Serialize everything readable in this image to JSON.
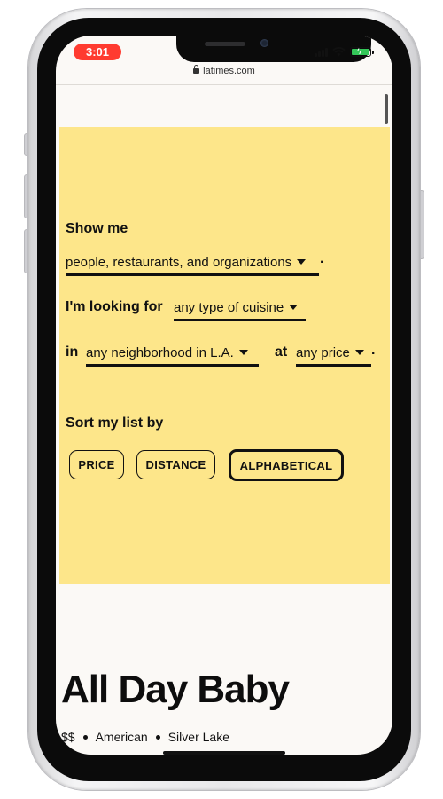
{
  "status_bar": {
    "time": "3:01"
  },
  "browser": {
    "url": "latimes.com"
  },
  "filter": {
    "show_me_label": "Show me",
    "show_me_value": "people, restaurants, and organizations",
    "period": ".",
    "looking_for_label": "I'm looking for",
    "cuisine_value": "any type of cuisine",
    "in_label": "in",
    "neighborhood_value": "any neighborhood in L.A.",
    "at_label": "at",
    "price_value": "any price",
    "sort_label": "Sort my list by",
    "sort_buttons": [
      "PRICE",
      "DISTANCE",
      "ALPHABETICAL"
    ],
    "sort_active": "ALPHABETICAL"
  },
  "result": {
    "title": "All Day Baby",
    "price": "$$",
    "cuisine": "American",
    "neighborhood": "Silver Lake"
  },
  "colors": {
    "panel": "#fde68a",
    "page_bg": "#fbf9f6",
    "time_pill": "#ff3b30",
    "battery": "#34c759"
  }
}
